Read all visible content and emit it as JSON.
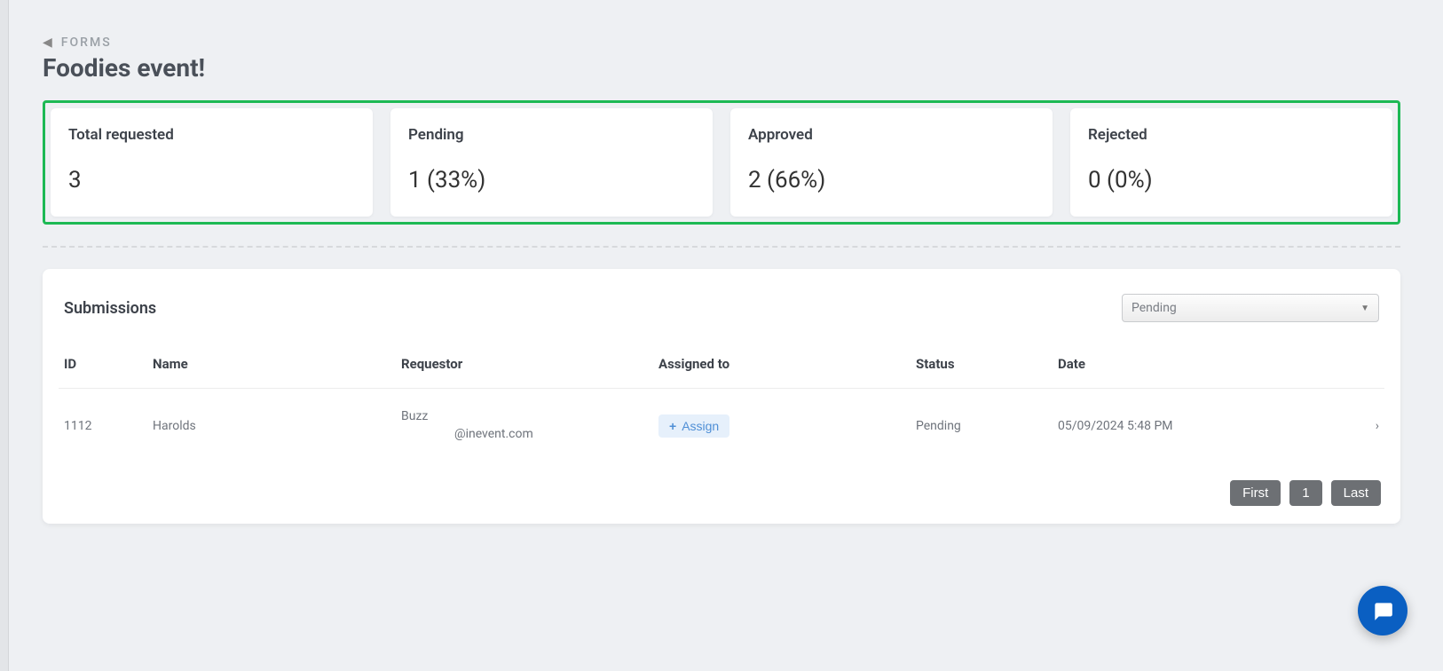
{
  "breadcrumb": {
    "label": "FORMS"
  },
  "page_title": "Foodies event!",
  "stats": {
    "total": {
      "label": "Total requested",
      "value": "3"
    },
    "pending": {
      "label": "Pending",
      "value": "1 (33%)"
    },
    "approved": {
      "label": "Approved",
      "value": "2 (66%)"
    },
    "rejected": {
      "label": "Rejected",
      "value": "0 (0%)"
    }
  },
  "submissions": {
    "title": "Submissions",
    "filter_selected": "Pending",
    "columns": {
      "id": "ID",
      "name": "Name",
      "requestor": "Requestor",
      "assigned_to": "Assigned to",
      "status": "Status",
      "date": "Date"
    },
    "rows": [
      {
        "id": "1112",
        "name": "Harolds",
        "requestor_name": "Buzz",
        "requestor_email": "@inevent.com",
        "assign_label": "Assign",
        "status": "Pending",
        "date": "05/09/2024 5:48 PM"
      }
    ],
    "pagination": {
      "first": "First",
      "page": "1",
      "last": "Last"
    }
  }
}
